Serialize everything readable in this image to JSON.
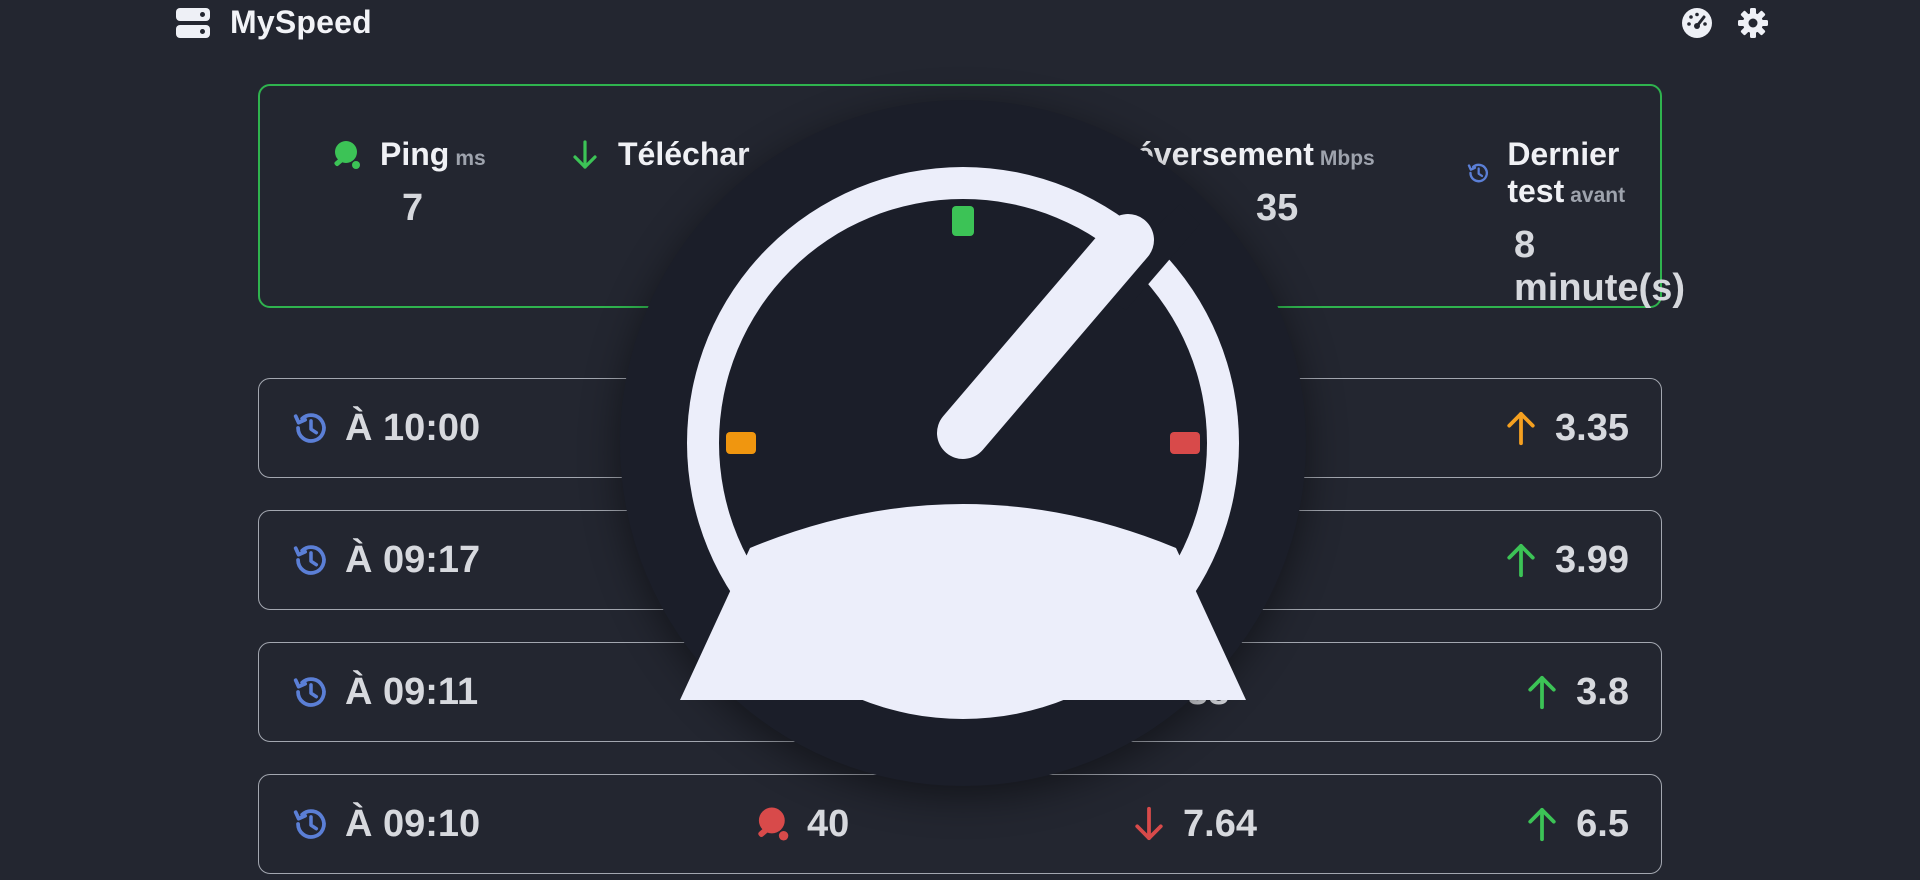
{
  "header": {
    "brand": "MySpeed",
    "brand_icon": "server-icon",
    "actions": [
      {
        "name": "speedometer-button",
        "icon": "speedometer-icon"
      },
      {
        "name": "settings-button",
        "icon": "gear-icon"
      }
    ]
  },
  "stats": {
    "ping": {
      "label": "Ping",
      "unit": "ms",
      "value": "7",
      "icon": "ping-pong-icon",
      "color": "#3cc356"
    },
    "download": {
      "label": "Téléchar",
      "icon": "arrow-down-icon",
      "color": "#3cc356"
    },
    "upload": {
      "label": "éversement",
      "unit": "Mbps",
      "value": "35"
    },
    "last_test": {
      "label": "Dernier test",
      "unit": "avant",
      "value": "8 minute(s)",
      "icon": "history-icon",
      "color": "#5b7fd6"
    }
  },
  "history": [
    {
      "time": "À 10:00",
      "upload": "3.35",
      "upload_color": "#f5a020"
    },
    {
      "time": "À 09:17",
      "upload": "3.99",
      "upload_color": "#3cc356"
    },
    {
      "time": "À 09:11",
      "download": "38",
      "upload": "3.8",
      "upload_color": "#3cc356"
    },
    {
      "time": "À 09:10",
      "ping": "40",
      "download": "7.64",
      "upload": "6.5",
      "ping_color": "#d84a4a",
      "download_color": "#d84a4a",
      "upload_color": "#3cc356"
    }
  ],
  "overlay": {
    "icon": "speedometer-logo-icon",
    "tick_colors": [
      "#3cc356",
      "#f0960f",
      "#d84a4a"
    ]
  }
}
